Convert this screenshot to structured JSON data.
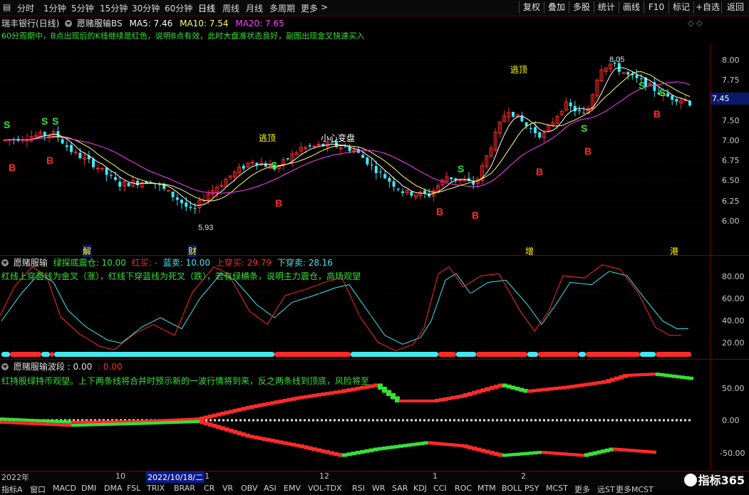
{
  "toolbar": {
    "timeframes": [
      "分时",
      "1分钟",
      "5分钟",
      "15分钟",
      "30分钟",
      "60分钟",
      "日线",
      "周线",
      "月线",
      "多周期",
      "更多"
    ],
    "more_arrow": ">",
    "right_buttons": [
      "复权",
      "叠加",
      "多股",
      "统计",
      "画线",
      "F10",
      "标记",
      "+自选",
      "返回"
    ]
  },
  "main": {
    "stock_title": "瑞丰银行(日线)",
    "indicator_name": "愿赌服输BS",
    "ma5": "MA5: 7.46",
    "ma10": "MA10: 7.54",
    "ma20": "MA20: 7.65",
    "tip": "60分周期中，B点出现后的K线继续是红色，说明B点有效，此时大盘准状态良好，副图出现金叉快速买入",
    "annotations": [
      "逃顶",
      "小心变盘",
      "逃顶"
    ],
    "high_label": "8.05",
    "low_label": "5.93",
    "current_price": "7.45",
    "y_labels": [
      "8.00",
      "7.75",
      "7.50",
      "7.25",
      "7.00",
      "6.75",
      "6.50",
      "6.25",
      "6.00"
    ],
    "events": [
      "解",
      "财",
      "增",
      "港"
    ]
  },
  "panel2": {
    "name": "愿赌服输",
    "v1": "绿探底震仓: 10.00",
    "v2": "红买: -",
    "v3": "蓝卖: 10.00",
    "v4": "上穿买: 29.79",
    "v5": "下穿卖: 28.16",
    "tip": "红线上穿蓝线为金叉（涨），红线下穿蓝线为死叉（跌），若有绿横条，说明主力震仓，高场观望",
    "y_labels": [
      "80.00",
      "60.00",
      "40.00",
      "20.00"
    ]
  },
  "panel3": {
    "name": "愿赌服输波段",
    "v1": ": 0.00",
    "v2": ": 0.00",
    "tip": "红持股绿持币观望。上下两条线将合并时预示新的一波行情将到来，反之两条线到顶底，风险将至",
    "y_labels": [
      "50.00",
      "0.00",
      "-50.00"
    ]
  },
  "dates": {
    "year": "2022年",
    "m10": "10",
    "cursor": "2022/10/18/二",
    "m11": "1",
    "m12": "12",
    "m1": "1",
    "m2": "2"
  },
  "bottom_tabs": [
    "指标A",
    "窗口",
    "MACD",
    "DMI",
    "DMA",
    "FSL",
    "TRIX",
    "BRAR",
    "CR",
    "VR",
    "OBV",
    "ASI",
    "EMV",
    "VOL-TDX",
    "RSI",
    "WR",
    "SAR",
    "KDJ",
    "CCI",
    "ROC",
    "MTM",
    "BOLL",
    "PSY",
    "MCST",
    "更多",
    "远ST",
    "更多MCST"
  ],
  "watermark": "指标365",
  "colors": {
    "up": "#ff2a2a",
    "down": "#40e8f0",
    "ma5": "#ffffff",
    "ma10": "#ffff66",
    "ma20": "#ff40ff",
    "green": "#36e036",
    "yellow": "#ffff00"
  }
}
